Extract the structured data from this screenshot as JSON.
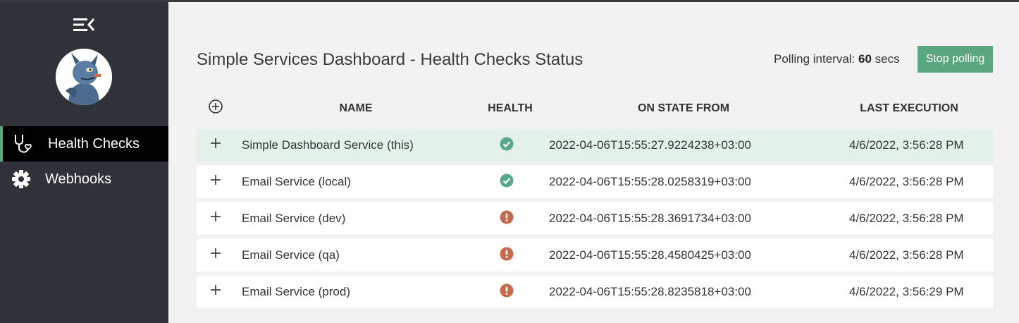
{
  "sidebar": {
    "menu_icon": "menu-collapse-icon",
    "avatar": "user-avatar",
    "items": [
      {
        "label": "Health Checks",
        "icon": "stethoscope-icon",
        "active": true
      },
      {
        "label": "Webhooks",
        "icon": "gear-icon",
        "active": false
      }
    ]
  },
  "header": {
    "title": "Simple Services Dashboard - Health Checks Status",
    "polling_label": "Polling interval: ",
    "polling_value": "60",
    "polling_unit": " secs",
    "stop_button": "Stop polling"
  },
  "table": {
    "columns": [
      "NAME",
      "HEALTH",
      "ON STATE FROM",
      "LAST EXECUTION"
    ],
    "rows": [
      {
        "name": "Simple Dashboard Service (this)",
        "health": "healthy",
        "on_state_from": "2022-04-06T15:55:27.9224238+03:00",
        "last_execution": "4/6/2022, 3:56:28 PM"
      },
      {
        "name": "Email Service (local)",
        "health": "healthy",
        "on_state_from": "2022-04-06T15:55:28.0258319+03:00",
        "last_execution": "4/6/2022, 3:56:28 PM"
      },
      {
        "name": "Email Service (dev)",
        "health": "unhealthy",
        "on_state_from": "2022-04-06T15:55:28.3691734+03:00",
        "last_execution": "4/6/2022, 3:56:28 PM"
      },
      {
        "name": "Email Service (qa)",
        "health": "unhealthy",
        "on_state_from": "2022-04-06T15:55:28.4580425+03:00",
        "last_execution": "4/6/2022, 3:56:28 PM"
      },
      {
        "name": "Email Service (prod)",
        "health": "unhealthy",
        "on_state_from": "2022-04-06T15:55:28.8235818+03:00",
        "last_execution": "4/6/2022, 3:56:29 PM"
      }
    ]
  },
  "colors": {
    "sidebar_bg": "#2f3238",
    "accent": "#5aa77f",
    "healthy": "#5aa78a",
    "unhealthy": "#c8694a",
    "highlight_row": "#e2f1ea"
  }
}
